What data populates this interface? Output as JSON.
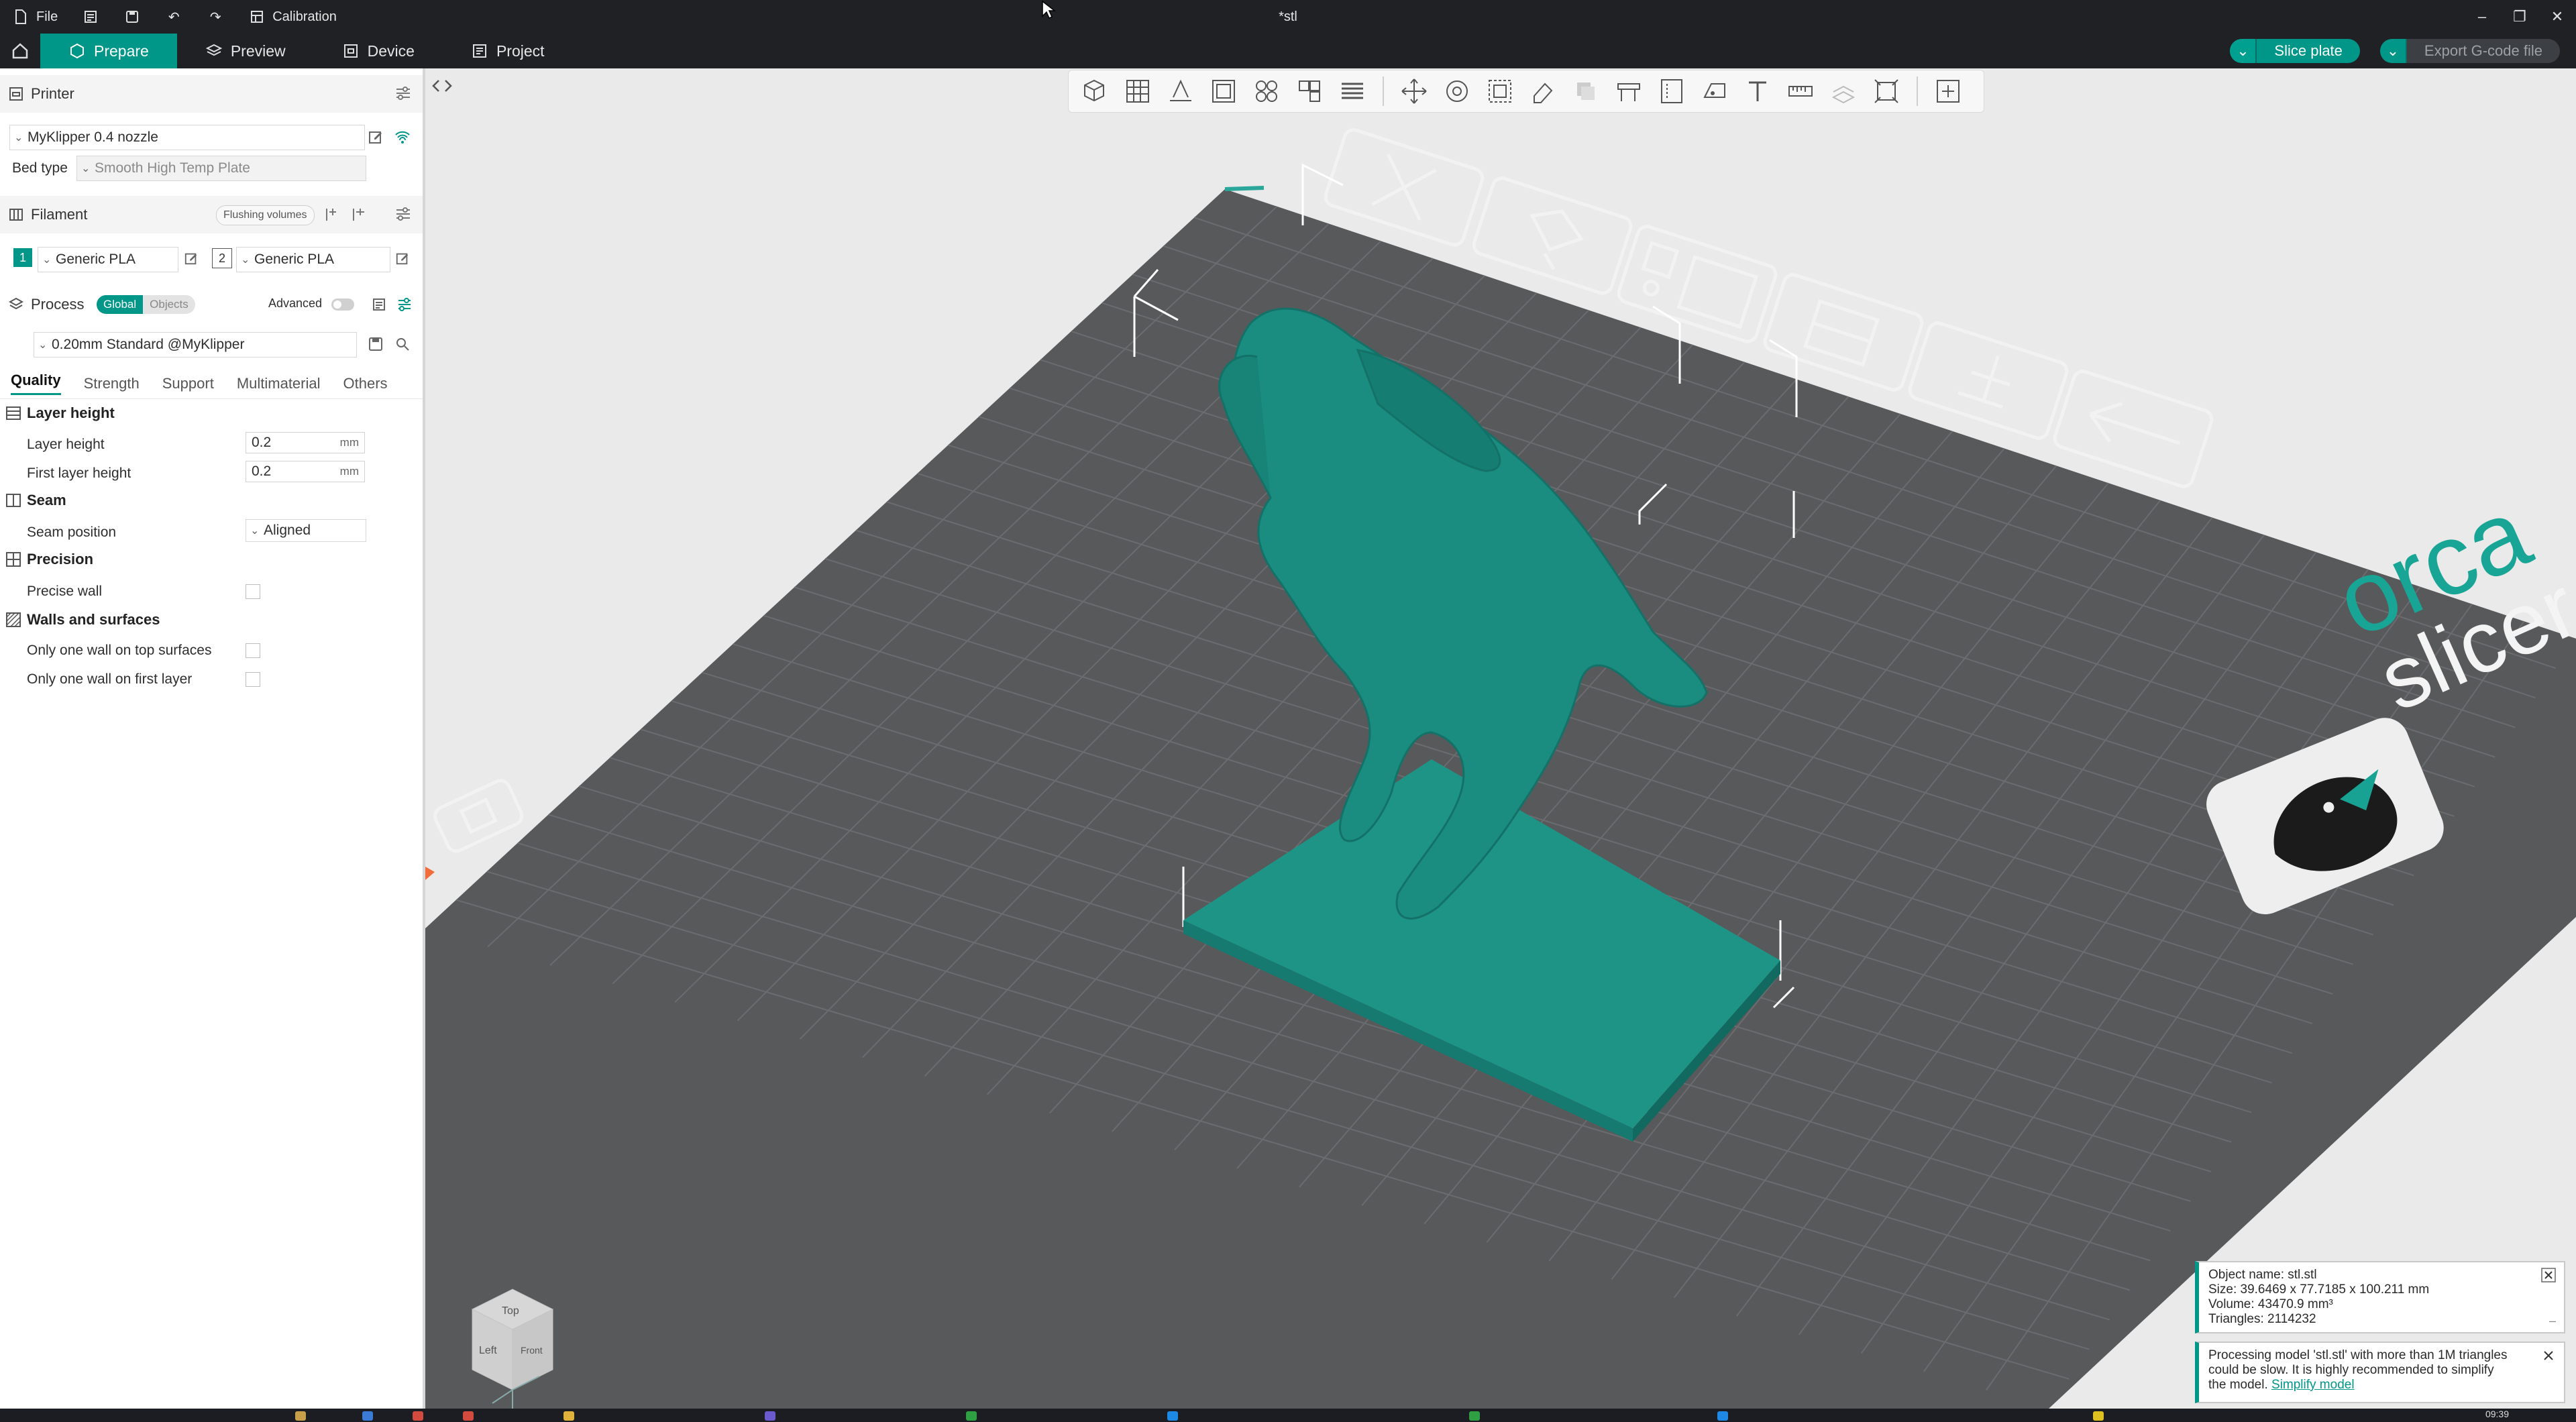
{
  "titlebar": {
    "menu_file": "File",
    "calibration": "Calibration",
    "window_title": "*stl"
  },
  "tabs": [
    {
      "label": "Prepare",
      "active": true
    },
    {
      "label": "Preview",
      "active": false
    },
    {
      "label": "Device",
      "active": false
    },
    {
      "label": "Project",
      "active": false
    }
  ],
  "actions": {
    "slice": "Slice plate",
    "export": "Export G-code file"
  },
  "printer": {
    "section": "Printer",
    "name": "MyKlipper 0.4 nozzle",
    "bed_label": "Bed type",
    "bed_value": "Smooth High Temp Plate"
  },
  "filament": {
    "section": "Filament",
    "flushing": "Flushing volumes",
    "items": [
      {
        "num": "1",
        "name": "Generic PLA",
        "color": "#009688"
      },
      {
        "num": "2",
        "name": "Generic PLA",
        "color": "#ffffff"
      }
    ]
  },
  "process": {
    "section": "Process",
    "seg_global": "Global",
    "seg_objects": "Objects",
    "advanced": "Advanced",
    "preset": "0.20mm Standard @MyKlipper",
    "subtabs": [
      "Quality",
      "Strength",
      "Support",
      "Multimaterial",
      "Others"
    ]
  },
  "quality": {
    "layer_group": "Layer height",
    "layer_height_label": "Layer height",
    "layer_height_value": "0.2",
    "first_layer_label": "First layer height",
    "first_layer_value": "0.2",
    "unit": "mm",
    "seam_group": "Seam",
    "seam_pos_label": "Seam position",
    "seam_pos_value": "Aligned",
    "precision_group": "Precision",
    "precise_wall_label": "Precise wall",
    "walls_group": "Walls and surfaces",
    "one_wall_top_label": "Only one wall on top surfaces",
    "one_wall_first_label": "Only one wall on first layer"
  },
  "viewcube": {
    "top": "Top",
    "left": "Left",
    "front": "Front"
  },
  "bed_logo": {
    "word1": "orca",
    "word2": "slicer"
  },
  "object_info": {
    "name": "Object name: stl.stl",
    "size": "Size: 39.6469 x 77.7185 x 100.211 mm",
    "volume": "Volume: 43470.9 mm³",
    "triangles": "Triangles: 2114232"
  },
  "warning": {
    "line1": "Processing model 'stl.stl' with more than 1M triangles",
    "line2": "could be slow. It is highly recommended to simplify",
    "line3_prefix": "the model.",
    "link": "Simplify model"
  },
  "taskbar": {
    "clock": "09:39"
  },
  "colors": {
    "accent": "#009688",
    "model": "#1b8f83",
    "bed": "#5a5b5d",
    "grid": "#6c6d70"
  }
}
